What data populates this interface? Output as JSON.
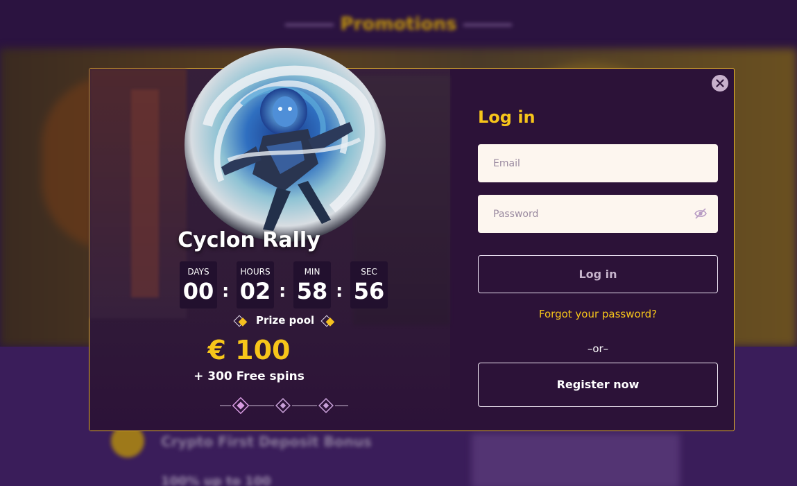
{
  "background": {
    "heading": "Promotions",
    "promo_row_1": "Crypto First Deposit Bonus",
    "promo_row_2": "100% up to 100"
  },
  "promo": {
    "title": "Cyclon Rally",
    "countdown": [
      {
        "label": "DAYS",
        "value": "00"
      },
      {
        "label": "HOURS",
        "value": "02"
      },
      {
        "label": "MIN",
        "value": "58"
      },
      {
        "label": "SEC",
        "value": "56"
      }
    ],
    "separator": ":",
    "prize_label": "Prize pool",
    "prize_amount": "€ 100",
    "prize_spins": "+ 300 Free spins"
  },
  "login": {
    "title": "Log in",
    "email_placeholder": "Email",
    "password_placeholder": "Password",
    "login_button": "Log in",
    "forgot_password": "Forgot your password?",
    "or_text": "–or–",
    "register_button": "Register now"
  },
  "colors": {
    "accent": "#f7c51a",
    "modal_border": "#e6b52a",
    "modal_bg": "#2c1238",
    "field_bg": "#fdf6ef"
  },
  "icons": [
    "close-icon",
    "eye-slash-icon",
    "sparkle-diamond-icon",
    "diamond-ornament-icon"
  ]
}
